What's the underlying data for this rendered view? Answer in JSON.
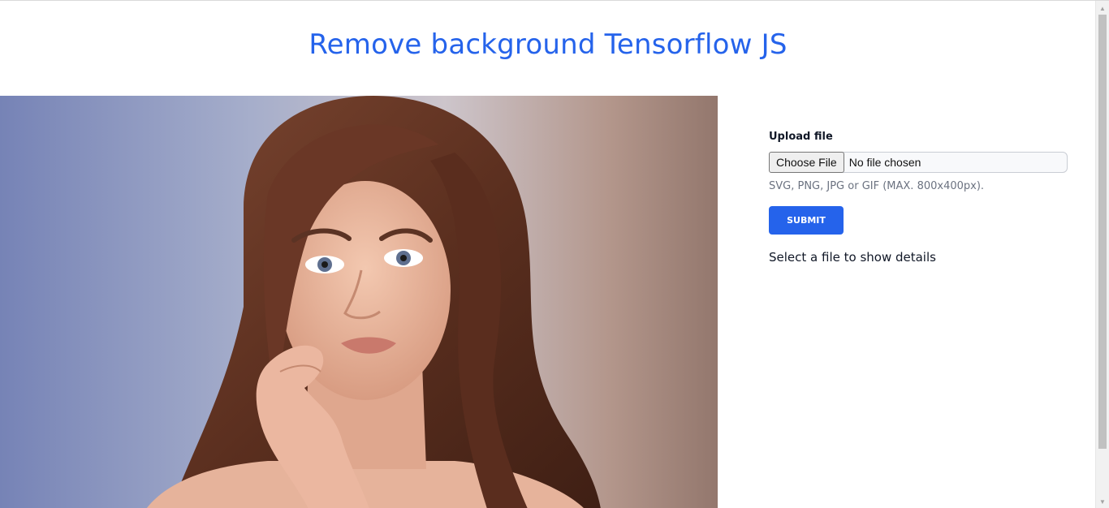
{
  "header": {
    "title": "Remove background Tensorflow JS"
  },
  "photo": {
    "description_icon": "portrait-image"
  },
  "form": {
    "upload_label": "Upload file",
    "choose_button_label": "Choose File",
    "file_status": "No file chosen",
    "hint": "SVG, PNG, JPG or GIF (MAX. 800x400px).",
    "submit_label": "SUBMIT",
    "details_text": "Select a file to show details"
  },
  "colors": {
    "accent": "#2563eb",
    "text": "#111827",
    "muted": "#6b7280"
  },
  "scrollbar": {
    "up_icon": "scroll-up-arrow-icon",
    "down_icon": "scroll-down-arrow-icon"
  }
}
